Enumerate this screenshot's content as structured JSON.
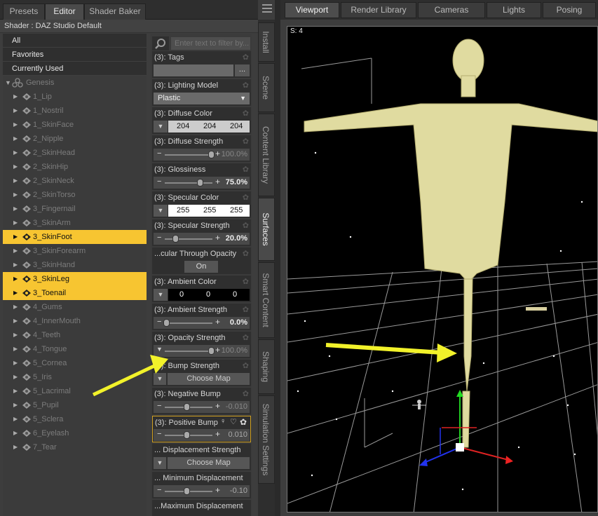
{
  "left_tabs": [
    "Presets",
    "Editor",
    "Shader Baker"
  ],
  "shader_label": "Shader : DAZ Studio Default",
  "tree_top": [
    "All",
    "Favorites",
    "Currently Used"
  ],
  "tree_root": "Genesis",
  "surfaces": [
    {
      "label": "1_Lip",
      "selected": false
    },
    {
      "label": "1_Nostril",
      "selected": false
    },
    {
      "label": "1_SkinFace",
      "selected": false
    },
    {
      "label": "2_Nipple",
      "selected": false
    },
    {
      "label": "2_SkinHead",
      "selected": false
    },
    {
      "label": "2_SkinHip",
      "selected": false
    },
    {
      "label": "2_SkinNeck",
      "selected": false
    },
    {
      "label": "2_SkinTorso",
      "selected": false
    },
    {
      "label": "3_Fingernail",
      "selected": false
    },
    {
      "label": "3_SkinArm",
      "selected": false
    },
    {
      "label": "3_SkinFoot",
      "selected": true
    },
    {
      "label": "3_SkinForearm",
      "selected": false
    },
    {
      "label": "3_SkinHand",
      "selected": false
    },
    {
      "label": "3_SkinLeg",
      "selected": true
    },
    {
      "label": "3_Toenail",
      "selected": true
    },
    {
      "label": "4_Gums",
      "selected": false
    },
    {
      "label": "4_InnerMouth",
      "selected": false
    },
    {
      "label": "4_Teeth",
      "selected": false
    },
    {
      "label": "4_Tongue",
      "selected": false
    },
    {
      "label": "5_Cornea",
      "selected": false
    },
    {
      "label": "5_Iris",
      "selected": false
    },
    {
      "label": "5_Lacrimal",
      "selected": false
    },
    {
      "label": "5_Pupil",
      "selected": false
    },
    {
      "label": "5_Sclera",
      "selected": false
    },
    {
      "label": "6_Eyelash",
      "selected": false
    },
    {
      "label": "7_Tear",
      "selected": false
    }
  ],
  "filter_placeholder": "Enter text to filter by...",
  "props": {
    "tags": {
      "title": "(3): Tags",
      "button": "..."
    },
    "lighting_model": {
      "title": "(3): Lighting Model",
      "value": "Plastic"
    },
    "diffuse_color": {
      "title": "(3): Diffuse Color",
      "r": "204",
      "g": "204",
      "b": "204"
    },
    "diffuse_strength": {
      "title": "(3): Diffuse Strength",
      "value": "100.0%",
      "level": 1.0
    },
    "glossiness": {
      "title": "(3): Glossiness",
      "value": "75.0%",
      "level": 0.75
    },
    "specular_color": {
      "title": "(3): Specular Color",
      "r": "255",
      "g": "255",
      "b": "255"
    },
    "specular_strength": {
      "title": "(3): Specular Strength",
      "value": "20.0%",
      "level": 0.2
    },
    "spec_through_opacity": {
      "title": "...cular Through Opacity",
      "value": "On"
    },
    "ambient_color": {
      "title": "(3): Ambient Color",
      "r": "0",
      "g": "0",
      "b": "0"
    },
    "ambient_strength": {
      "title": "(3): Ambient Strength",
      "value": "0.0%",
      "level": 0.0
    },
    "opacity_strength": {
      "title": "(3): Opacity Strength",
      "value": "100.0%",
      "level": 1.0
    },
    "bump_strength": {
      "title": "(3): Bump Strength",
      "button": "Choose Map"
    },
    "negative_bump": {
      "title": "(3): Negative Bump",
      "value": "-0.010",
      "level": 0.45
    },
    "positive_bump": {
      "title": "(3): Positive Bump",
      "value": "0.010",
      "level": 0.45
    },
    "displacement_strength": {
      "title": "... Displacement Strength",
      "button": "Choose Map"
    },
    "min_displacement": {
      "title": "... Minimum Displacement",
      "value": "-0.10",
      "level": 0.45
    },
    "max_displacement": {
      "title": "...Maximum Displacement"
    }
  },
  "vertical_tabs": [
    "Install",
    "Scene",
    "Content Library",
    "Surfaces",
    "Smart Content",
    "Shaping",
    "Simulation Settings"
  ],
  "right_tabs": [
    "Viewport",
    "Render Library",
    "Cameras",
    "Lights",
    "Posing"
  ],
  "viewport_label": "S: 4",
  "colors": {
    "selection": "#f7c531",
    "arrow": "#f2f22a",
    "figure": "#e0dba0"
  },
  "icons": [
    "search-icon",
    "gear-icon",
    "genesis-figure-icon",
    "surface-icon",
    "expand-triangle-icon",
    "lock-icon",
    "heart-icon"
  ]
}
